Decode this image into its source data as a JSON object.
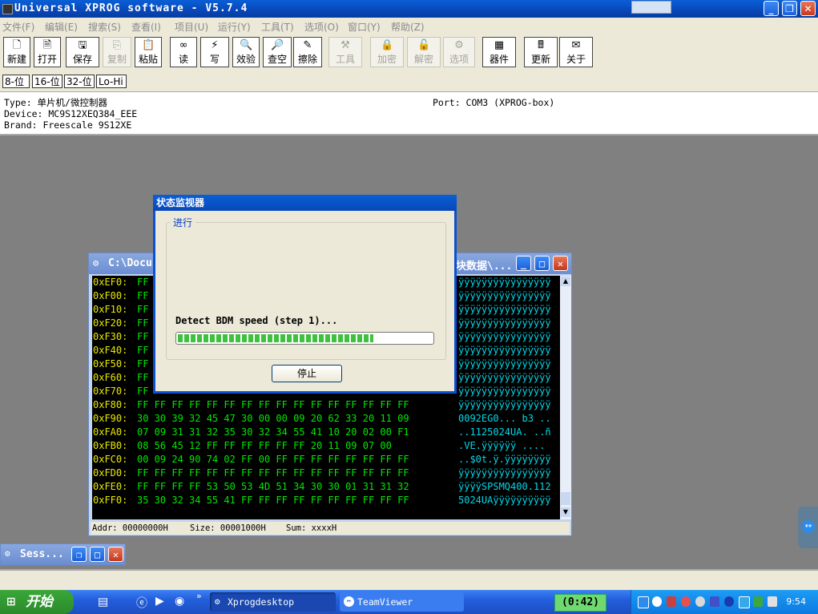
{
  "window": {
    "title": "Universal XPROG software - V5.7.4"
  },
  "menu": [
    "文件(F)",
    "编辑(E)",
    "搜索(S)",
    "查看(I)",
    "项目(U)",
    "运行(Y)",
    "工具(T)",
    "选项(O)",
    "窗口(Y)",
    "帮助(Z)"
  ],
  "toolbar": [
    {
      "label": "新建",
      "icon": "new-file-icon",
      "enabled": true
    },
    {
      "label": "打开",
      "icon": "open-file-icon",
      "enabled": true
    },
    {
      "label": "保存",
      "icon": "save-icon",
      "enabled": true
    },
    {
      "label": "复制",
      "icon": "copy-icon",
      "enabled": false
    },
    {
      "label": "粘贴",
      "icon": "paste-icon",
      "enabled": true
    },
    {
      "label": "读",
      "icon": "read-icon",
      "enabled": true
    },
    {
      "label": "写",
      "icon": "write-icon",
      "enabled": true
    },
    {
      "label": "效验",
      "icon": "verify-icon",
      "enabled": true
    },
    {
      "label": "查空",
      "icon": "blank-check-icon",
      "enabled": true
    },
    {
      "label": "擦除",
      "icon": "erase-icon",
      "enabled": true
    },
    {
      "label": "工具",
      "icon": "tools-icon",
      "enabled": false
    },
    {
      "label": "加密",
      "icon": "lock-icon",
      "enabled": false
    },
    {
      "label": "解密",
      "icon": "unlock-icon",
      "enabled": false
    },
    {
      "label": "选项",
      "icon": "options-icon",
      "enabled": false
    },
    {
      "label": "器件",
      "icon": "device-icon",
      "enabled": true
    },
    {
      "label": "更新",
      "icon": "update-icon",
      "enabled": true
    },
    {
      "label": "关于",
      "icon": "about-icon",
      "enabled": true
    }
  ],
  "bit_buttons": [
    "8-位",
    "16-位",
    "32-位",
    "Lo-Hi"
  ],
  "info": {
    "type": "Type: 单片机/微控制器",
    "device": "Device: MC9S12XEQ384_EEE",
    "brand": "Brand: Freescale 9S12XE",
    "port": "Port: COM3 (XPROG-box)"
  },
  "hex_window": {
    "title_left": "C:\\Docu",
    "title_right": "块数据\\...",
    "rows": [
      {
        "addr": "0xEF0:",
        "bytes": "FF",
        "ascii": "ÿÿÿÿÿÿÿÿÿÿÿÿÿÿÿÿ"
      },
      {
        "addr": "0xF00:",
        "bytes": "FF",
        "ascii": "ÿÿÿÿÿÿÿÿÿÿÿÿÿÿÿÿ"
      },
      {
        "addr": "0xF10:",
        "bytes": "FF",
        "ascii": "ÿÿÿÿÿÿÿÿÿÿÿÿÿÿÿÿ"
      },
      {
        "addr": "0xF20:",
        "bytes": "FF",
        "ascii": "ÿÿÿÿÿÿÿÿÿÿÿÿÿÿÿÿ"
      },
      {
        "addr": "0xF30:",
        "bytes": "FF",
        "ascii": "ÿÿÿÿÿÿÿÿÿÿÿÿÿÿÿÿ"
      },
      {
        "addr": "0xF40:",
        "bytes": "FF",
        "ascii": "ÿÿÿÿÿÿÿÿÿÿÿÿÿÿÿÿ"
      },
      {
        "addr": "0xF50:",
        "bytes": "FF",
        "ascii": "ÿÿÿÿÿÿÿÿÿÿÿÿÿÿÿÿ"
      },
      {
        "addr": "0xF60:",
        "bytes": "FF",
        "ascii": "ÿÿÿÿÿÿÿÿÿÿÿÿÿÿÿÿ"
      },
      {
        "addr": "0xF70:",
        "bytes": "FF",
        "ascii": "ÿÿÿÿÿÿÿÿÿÿÿÿÿÿÿÿ"
      },
      {
        "addr": "0xF80:",
        "bytes": "FF FF FF FF FF FF FF FF FF FF FF FF FF FF FF FF",
        "ascii": "ÿÿÿÿÿÿÿÿÿÿÿÿÿÿÿÿ"
      },
      {
        "addr": "0xF90:",
        "bytes": "30 30 39 32 45 47 30 00 00 09 20 62 33 20 11 09",
        "ascii": "0092EG0... b3 .."
      },
      {
        "addr": "0xFA0:",
        "bytes": "07 09 31 31 32 35 30 32 34 55 41 10 20 02 00 F1",
        "ascii": "..1125024UA. ..ñ"
      },
      {
        "addr": "0xFB0:",
        "bytes": "08 56 45 12 FF FF FF FF FF FF 20 11 09 07 00",
        "ascii": ".VE.ÿÿÿÿÿÿ ...."
      },
      {
        "addr": "0xFC0:",
        "bytes": "00 09 24 90 74 02 FF 00 FF FF FF FF FF FF FF FF",
        "ascii": "..$0t.ÿ.ÿÿÿÿÿÿÿÿ"
      },
      {
        "addr": "0xFD0:",
        "bytes": "FF FF FF FF FF FF FF FF FF FF FF FF FF FF FF FF",
        "ascii": "ÿÿÿÿÿÿÿÿÿÿÿÿÿÿÿÿ"
      },
      {
        "addr": "0xFE0:",
        "bytes": "FF FF FF FF 53 50 53 4D 51 34 30 30 01 31 31 32",
        "ascii": "ÿÿÿÿSPSMQ400.112"
      },
      {
        "addr": "0xFF0:",
        "bytes": "35 30 32 34 55 41 FF FF FF FF FF FF FF FF FF FF",
        "ascii": "5024UAÿÿÿÿÿÿÿÿÿÿ"
      }
    ],
    "status": {
      "addr": "Addr: 00000000H",
      "size": "Size: 00001000H",
      "sum": "Sum: xxxxH"
    }
  },
  "dialog": {
    "title": "状态监视器",
    "group_label": "进行",
    "message": "Detect BDM speed (step 1)...",
    "progress": 0.77,
    "stop_label": "停止"
  },
  "session": {
    "title": "Sess..."
  },
  "taskbar": {
    "start_label": "开始",
    "tasks": [
      {
        "label": "Xprogdesktop",
        "icon": "xprog-icon"
      },
      {
        "label": "TeamViewer",
        "icon": "teamviewer-icon"
      }
    ],
    "timer": "(0:42)",
    "clock": "9:54"
  },
  "colors": {
    "hex_addr": "#e8e800",
    "hex_bytes": "#00e800",
    "hex_ascii": "#00d8e8",
    "titlebar": "#0a5fd6"
  }
}
